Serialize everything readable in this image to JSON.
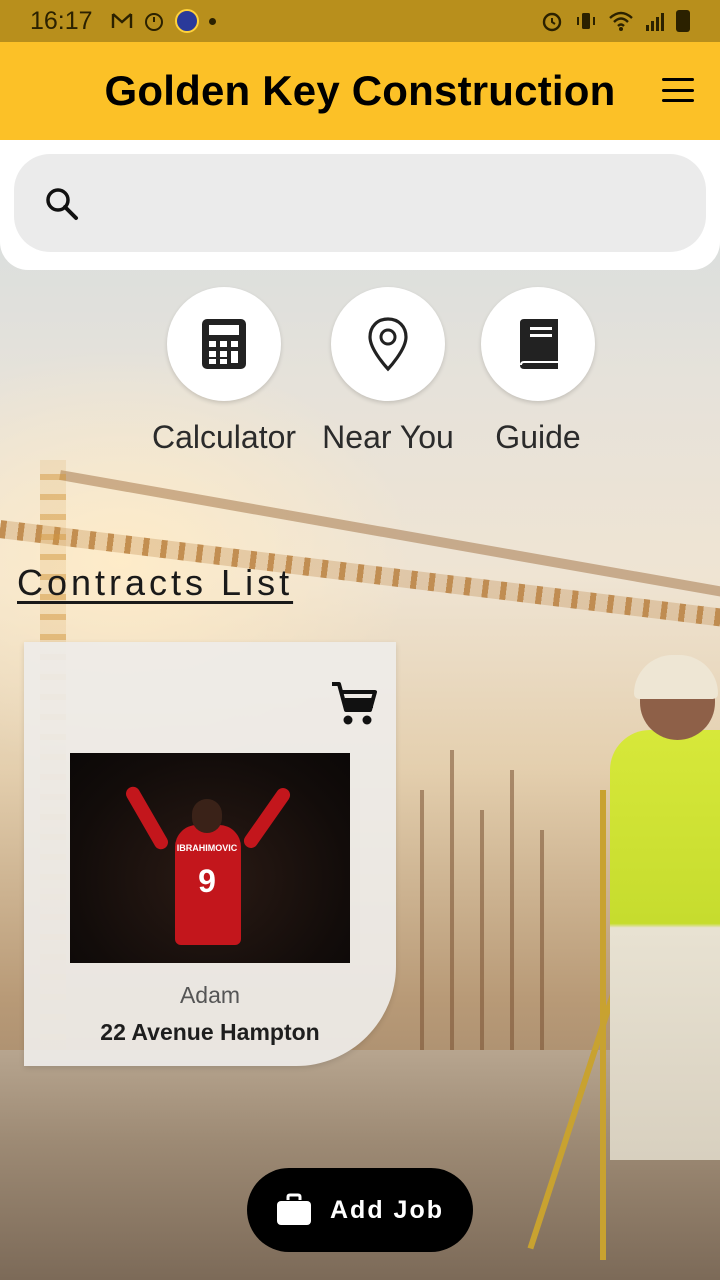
{
  "status_bar": {
    "time": "16:17",
    "left_icons": [
      "gmail-icon",
      "timer-icon",
      "globe-icon",
      "dot-icon"
    ],
    "right_icons": [
      "alarm-icon",
      "vibrate-icon",
      "wifi-icon",
      "signal-icon",
      "battery-icon"
    ]
  },
  "app_bar": {
    "title": "Golden Key Construction",
    "menu_icon": "hamburger-menu-icon"
  },
  "search": {
    "placeholder": "",
    "icon": "search-icon"
  },
  "quick_actions": [
    {
      "label": "Calculator",
      "icon": "calculator-icon"
    },
    {
      "label": "Near You",
      "icon": "location-pin-icon"
    },
    {
      "label": "Guide",
      "icon": "book-icon"
    }
  ],
  "contracts": {
    "heading": "Contracts List",
    "items": [
      {
        "owner": "Adam",
        "address": "22 Avenue Hampton",
        "action_icon": "cart-icon",
        "image_jersey_number": "9",
        "image_jersey_name": "IBRAHIMOVIC"
      }
    ]
  },
  "fab": {
    "label": "Add Job",
    "icon": "briefcase-icon"
  },
  "colors": {
    "accent": "#fcc127",
    "status_bar": "#b88f1c",
    "fab_bg": "#000000"
  }
}
